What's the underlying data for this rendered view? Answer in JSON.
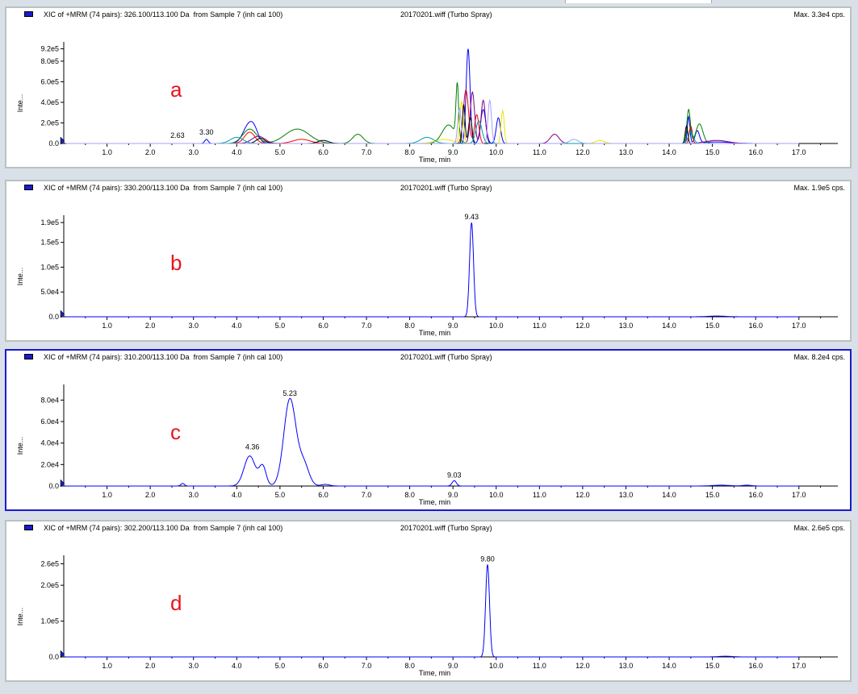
{
  "chart_data": [
    {
      "type": "line",
      "title": "XIC of +MRM (74 pairs): 326.100/113.100 Da  from Sample 7 (inh cal 100)",
      "source": "20170201.wiff (Turbo Spray)",
      "max_label": "Max. 3.3e4 cps.",
      "panel_label": "a",
      "xlabel": "Time, min",
      "ylabel": "Inte...",
      "xlim": [
        0,
        17.9
      ],
      "ylim": [
        0,
        940000
      ],
      "x_ticks": [
        "1.0",
        "2.0",
        "3.0",
        "4.0",
        "5.0",
        "6.0",
        "7.0",
        "8.0",
        "9.0",
        "10.0",
        "11.0",
        "12.0",
        "13.0",
        "14.0",
        "15.0",
        "16.0",
        "17.0"
      ],
      "y_ticks": [
        {
          "v": 0,
          "label": "0.0"
        },
        {
          "v": 200000,
          "label": "2.0e5"
        },
        {
          "v": 400000,
          "label": "4.0e5"
        },
        {
          "v": 600000,
          "label": "6.0e5"
        },
        {
          "v": 800000,
          "label": "8.0e5"
        },
        {
          "v": 920000,
          "label": "9.2e5"
        }
      ],
      "peak_labels": [
        {
          "x": 2.63,
          "y": 25000,
          "label": "2.63"
        },
        {
          "x": 3.3,
          "y": 55000,
          "label": "3.30"
        }
      ],
      "series": [
        {
          "color": "#0000ff",
          "peaks": [
            [
              3.3,
              40000,
              0.04
            ],
            [
              4.25,
              150000,
              0.12
            ],
            [
              4.4,
              120000,
              0.1
            ],
            [
              9.35,
              920000,
              0.045
            ],
            [
              9.7,
              330000,
              0.06
            ],
            [
              10.05,
              250000,
              0.05
            ],
            [
              14.45,
              260000,
              0.03
            ],
            [
              14.65,
              120000,
              0.05
            ],
            [
              15.1,
              15000,
              0.3
            ]
          ]
        },
        {
          "color": "#ff0000",
          "peaks": [
            [
              4.3,
              110000,
              0.12
            ],
            [
              5.5,
              40000,
              0.2
            ],
            [
              9.3,
              520000,
              0.06
            ],
            [
              9.55,
              280000,
              0.05
            ],
            [
              14.5,
              170000,
              0.035
            ]
          ]
        },
        {
          "color": "#008000",
          "peaks": [
            [
              4.3,
              140000,
              0.16
            ],
            [
              5.4,
              140000,
              0.28
            ],
            [
              6.8,
              90000,
              0.12
            ],
            [
              8.9,
              180000,
              0.15
            ],
            [
              9.1,
              520000,
              0.03
            ],
            [
              14.45,
              330000,
              0.04
            ],
            [
              14.7,
              190000,
              0.08
            ]
          ]
        },
        {
          "color": "#800080",
          "peaks": [
            [
              4.5,
              70000,
              0.15
            ],
            [
              9.45,
              500000,
              0.05
            ],
            [
              9.7,
              420000,
              0.05
            ],
            [
              11.35,
              90000,
              0.1
            ],
            [
              15.1,
              30000,
              0.25
            ]
          ]
        },
        {
          "color": "#e6e600",
          "peaks": [
            [
              8.8,
              40000,
              0.2
            ],
            [
              9.2,
              400000,
              0.04
            ],
            [
              10.15,
              320000,
              0.035
            ],
            [
              12.4,
              30000,
              0.1
            ]
          ]
        },
        {
          "color": "#000000",
          "peaks": [
            [
              4.55,
              50000,
              0.1
            ],
            [
              6.0,
              30000,
              0.12
            ],
            [
              9.25,
              380000,
              0.03
            ],
            [
              9.4,
              250000,
              0.04
            ],
            [
              14.4,
              170000,
              0.03
            ]
          ]
        },
        {
          "color": "#00a0a0",
          "peaks": [
            [
              4.0,
              60000,
              0.15
            ],
            [
              8.4,
              60000,
              0.15
            ],
            [
              9.6,
              220000,
              0.07
            ],
            [
              14.5,
              110000,
              0.06
            ]
          ]
        },
        {
          "color": "#a0a0ff",
          "peaks": [
            [
              9.15,
              340000,
              0.04
            ],
            [
              9.85,
              420000,
              0.04
            ],
            [
              11.8,
              40000,
              0.1
            ]
          ]
        }
      ]
    },
    {
      "type": "line",
      "title": "XIC of +MRM (74 pairs): 330.200/113.100 Da  from Sample 7 (inh cal 100)",
      "source": "20170201.wiff (Turbo Spray)",
      "max_label": "Max. 1.9e5 cps.",
      "panel_label": "b",
      "xlabel": "Time, min",
      "ylabel": "Inte...",
      "xlim": [
        0,
        17.9
      ],
      "ylim": [
        0,
        195000
      ],
      "x_ticks": [
        "1.0",
        "2.0",
        "3.0",
        "4.0",
        "5.0",
        "6.0",
        "7.0",
        "8.0",
        "9.0",
        "10.0",
        "11.0",
        "12.0",
        "13.0",
        "14.0",
        "15.0",
        "16.0",
        "17.0"
      ],
      "y_ticks": [
        {
          "v": 0,
          "label": "0.0"
        },
        {
          "v": 50000,
          "label": "5.0e4"
        },
        {
          "v": 100000,
          "label": "1.0e5"
        },
        {
          "v": 150000,
          "label": "1.5e5"
        },
        {
          "v": 190000,
          "label": "1.9e5"
        }
      ],
      "peak_labels": [
        {
          "x": 9.43,
          "y": 190000,
          "label": "9.43"
        }
      ],
      "series": [
        {
          "color": "#0000ff",
          "peaks": [
            [
              9.43,
              190000,
              0.045
            ],
            [
              15.1,
              1500,
              0.2
            ]
          ]
        }
      ]
    },
    {
      "type": "line",
      "title": "XIC of +MRM (74 pairs): 310.200/113.100 Da  from Sample 7 (inh cal 100)",
      "source": "20170201.wiff (Turbo Spray)",
      "max_label": "Max. 8.2e4 cps.",
      "panel_label": "c",
      "xlabel": "Time, min",
      "ylabel": "Inte...",
      "xlim": [
        0,
        17.9
      ],
      "ylim": [
        0,
        90000
      ],
      "x_ticks": [
        "1.0",
        "2.0",
        "3.0",
        "4.0",
        "5.0",
        "6.0",
        "7.0",
        "8.0",
        "9.0",
        "10.0",
        "11.0",
        "12.0",
        "13.0",
        "14.0",
        "15.0",
        "16.0",
        "17.0"
      ],
      "y_ticks": [
        {
          "v": 0,
          "label": "0.0"
        },
        {
          "v": 20000,
          "label": "2.0e4"
        },
        {
          "v": 40000,
          "label": "4.0e4"
        },
        {
          "v": 60000,
          "label": "6.0e4"
        },
        {
          "v": 80000,
          "label": "8.0e4"
        }
      ],
      "peak_labels": [
        {
          "x": 4.36,
          "y": 31000,
          "label": "4.36"
        },
        {
          "x": 5.23,
          "y": 81000,
          "label": "5.23"
        },
        {
          "x": 9.03,
          "y": 5000,
          "label": "9.03"
        }
      ],
      "series": [
        {
          "color": "#0000ff",
          "peaks": [
            [
              2.75,
              2500,
              0.04
            ],
            [
              4.3,
              28000,
              0.13
            ],
            [
              4.6,
              18000,
              0.08
            ],
            [
              5.23,
              81000,
              0.14
            ],
            [
              5.55,
              20000,
              0.12
            ],
            [
              6.05,
              1500,
              0.1
            ],
            [
              9.03,
              5000,
              0.05
            ],
            [
              15.2,
              800,
              0.2
            ],
            [
              15.8,
              800,
              0.1
            ]
          ]
        }
      ]
    },
    {
      "type": "line",
      "title": "XIC of +MRM (74 pairs): 302.200/113.100 Da  from Sample 7 (inh cal 100)",
      "source": "20170201.wiff (Turbo Spray)",
      "max_label": "Max. 2.6e5 cps.",
      "panel_label": "d",
      "xlabel": "Time, min",
      "ylabel": "Inte...",
      "xlim": [
        0,
        17.9
      ],
      "ylim": [
        0,
        270000
      ],
      "x_ticks": [
        "1.0",
        "2.0",
        "3.0",
        "4.0",
        "5.0",
        "6.0",
        "7.0",
        "8.0",
        "9.0",
        "10.0",
        "11.0",
        "12.0",
        "13.0",
        "14.0",
        "15.0",
        "16.0",
        "17.0"
      ],
      "y_ticks": [
        {
          "v": 0,
          "label": "0.0"
        },
        {
          "v": 100000,
          "label": "1.0e5"
        },
        {
          "v": 200000,
          "label": "2.0e5"
        },
        {
          "v": 260000,
          "label": "2.6e5"
        }
      ],
      "peak_labels": [
        {
          "x": 9.8,
          "y": 258000,
          "label": "9.80"
        }
      ],
      "series": [
        {
          "color": "#0000ff",
          "peaks": [
            [
              9.8,
              258000,
              0.045
            ],
            [
              15.3,
              2000,
              0.15
            ]
          ]
        }
      ]
    }
  ]
}
